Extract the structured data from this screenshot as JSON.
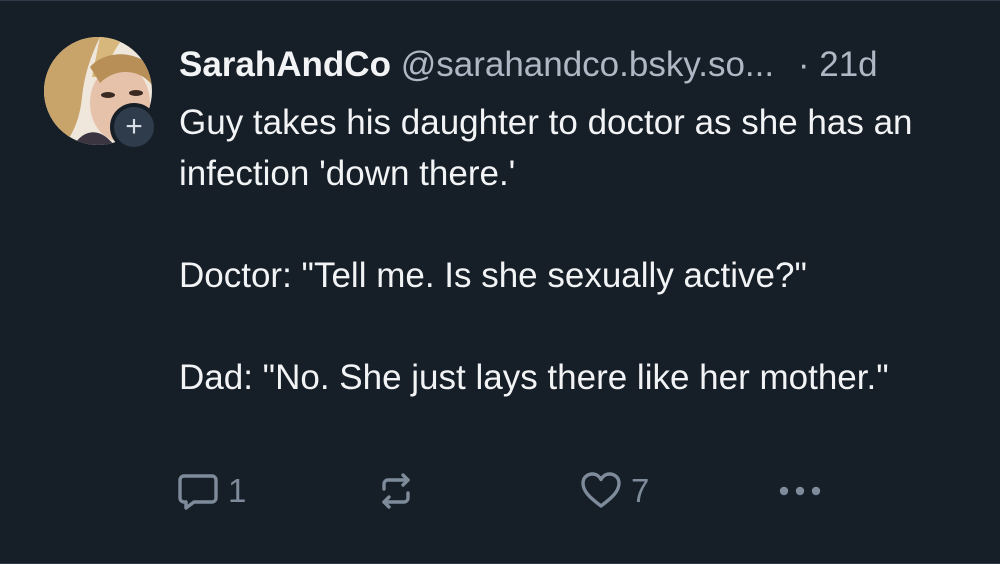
{
  "post": {
    "author": {
      "display_name": "SarahAndCo",
      "handle": "@sarahandco.bsky.so...",
      "avatar_icon": "user-avatar-photo",
      "follow_icon": "plus-icon",
      "follow_symbol": "+"
    },
    "separator": "·",
    "time": "21d",
    "text_paragraphs": [
      "Guy takes his daughter to doctor as she has an infection 'down there.'",
      "Doctor: \"Tell me. Is she sexually active?\"",
      "Dad: \"No. She just lays there like her mother.\""
    ],
    "actions": {
      "reply_icon": "comment-icon",
      "reply_count": "1",
      "repost_icon": "repost-icon",
      "like_icon": "heart-icon",
      "like_count": "7",
      "more_icon": "more-options-icon"
    }
  },
  "colors": {
    "background": "#161e27",
    "text_primary": "#f1f3f5",
    "text_secondary": "#aeb8c4",
    "icon": "#7d8b9b",
    "follow_badge": "#2f3c4c"
  }
}
